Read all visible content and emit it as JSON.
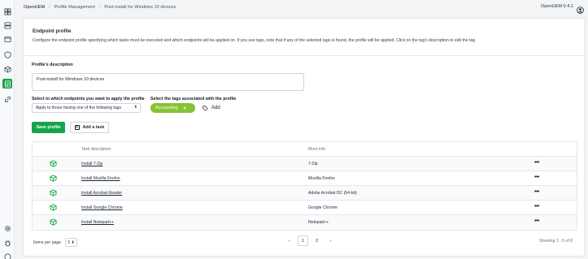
{
  "breadcrumb": {
    "home": "OpenUEM",
    "section": "Profile Management",
    "current": "Post-install for Windows 10 devices"
  },
  "version": "OpenUEM 0.4.1",
  "panel": {
    "title": "Endpoint profile",
    "description": "Configure the endpoint profile specifying which tasks must be executed and which endpoints will be applied on. If you use tags, note that if any of the selected tags is found, the profile will be applied. Click on the tag's description to edit the tag"
  },
  "form": {
    "description_label": "Profile's description",
    "description_value": "Post-install for Windows 10 devices",
    "apply_label": "Select to which endpoints you want to apply the profile",
    "apply_value": "Apply to those having one of the following tags",
    "tags_label": "Select the tags associated with the profile",
    "tags": [
      "Accounting"
    ],
    "add_tag_label": "Add",
    "tag_color": "#86c232"
  },
  "actions": {
    "save_label": "Save profile",
    "add_task_label": "Add a task",
    "primary_color": "#16a34a"
  },
  "table": {
    "headers": [
      "Task description",
      "More info"
    ],
    "rows": [
      {
        "desc": "Install 7-Zip",
        "info": "7-Zip",
        "icon": "package-icon"
      },
      {
        "desc": "Install Mozilla Firefox",
        "info": "Mozilla Firefox",
        "icon": "package-icon"
      },
      {
        "desc": "Install Acrobat Reader",
        "info": "Adobe Acrobat DC (64-bit)",
        "icon": "package-icon"
      },
      {
        "desc": "Install Google Chrome",
        "info": "Google Chrome",
        "icon": "package-icon"
      },
      {
        "desc": "Install Notepad++",
        "info": "Notepad++",
        "icon": "package-icon"
      }
    ],
    "more_label": "•••"
  },
  "footer": {
    "items_per_page_label": "Items per page",
    "items_per_page": "5",
    "pages": [
      "1",
      "2"
    ],
    "current_page": "1",
    "prev": "‹",
    "next": "›",
    "showing": "Showing 1 - 5 of 8"
  }
}
